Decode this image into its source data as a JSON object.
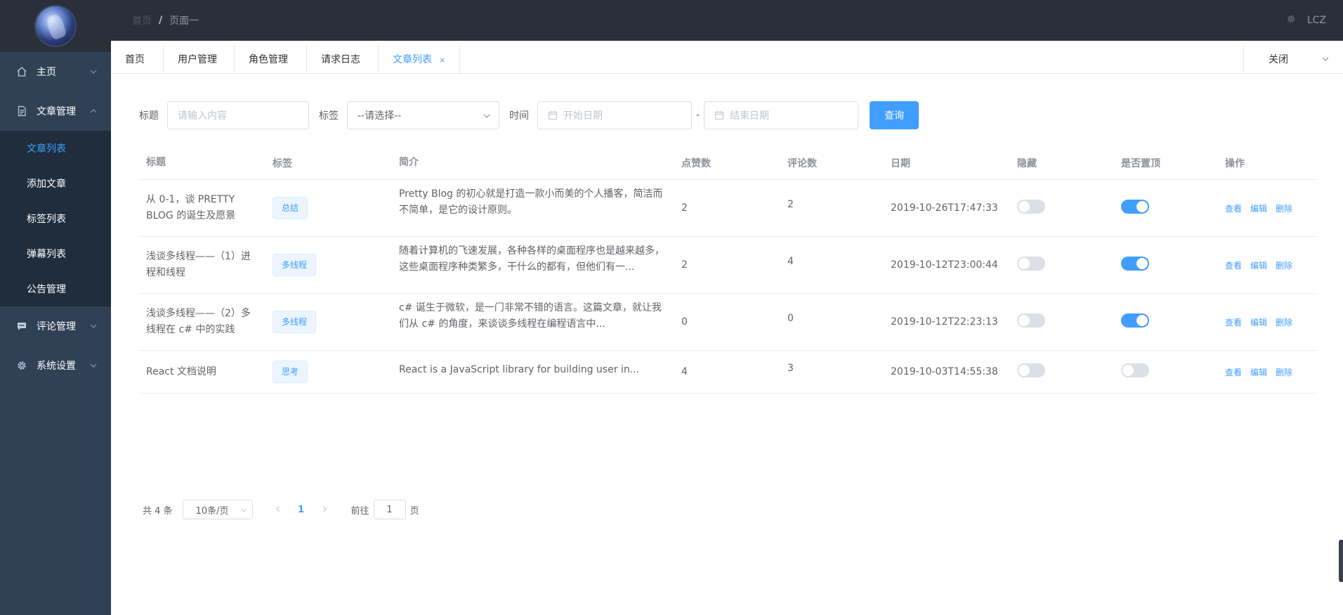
{
  "sidebar": {
    "menu": [
      {
        "label": "主页"
      },
      {
        "label": "文章管理"
      },
      {
        "label": "评论管理"
      },
      {
        "label": "系统设置"
      }
    ],
    "submenu": [
      {
        "label": "文章列表"
      },
      {
        "label": "添加文章"
      },
      {
        "label": "标签列表"
      },
      {
        "label": "弹幕列表"
      },
      {
        "label": "公告管理"
      }
    ]
  },
  "header": {
    "breadcrumb_home": "首页",
    "breadcrumb_sep": "/",
    "breadcrumb_current": "页面一",
    "user": "LCZ"
  },
  "tabs": {
    "items": [
      "首页",
      "用户管理",
      "角色管理",
      "请求日志",
      "文章列表"
    ],
    "close_icon": "×",
    "close_all_label": "关闭"
  },
  "filter": {
    "title_label": "标题",
    "title_placeholder": "请输入内容",
    "tag_label": "标签",
    "tag_selected": "--请选择--",
    "time_label": "时间",
    "start_placeholder": "开始日期",
    "range_sep": "-",
    "end_placeholder": "结束日期",
    "query_button": "查询"
  },
  "table": {
    "headers": [
      "标题",
      "标签",
      "简介",
      "点赞数",
      "评论数",
      "日期",
      "隐藏",
      "是否置顶",
      "操作"
    ],
    "rows": [
      {
        "title": "从 0-1，谈 PRETTY BLOG 的诞生及愿景",
        "tag": "总结",
        "desc": "Pretty Blog 的初心就是打造一款小而美的个人播客，简洁而不简单，是它的设计原则。",
        "likes": "2",
        "comments": "2",
        "date": "2019-10-26T17:47:33",
        "hidden": false,
        "top": true
      },
      {
        "title": "浅谈多线程——（1）进程和线程",
        "tag": "多线程",
        "desc": "随着计算机的飞速发展，各种各样的桌面程序也是越来越多，这些桌面程序种类繁多，干什么的都有，但他们有一...",
        "likes": "2",
        "comments": "4",
        "date": "2019-10-12T23:00:44",
        "hidden": false,
        "top": true
      },
      {
        "title": "浅谈多线程——（2）多线程在 c# 中的实践",
        "tag": "多线程",
        "desc": "c# 诞生于微软，是一门非常不错的语言。这篇文章，就让我们从 c# 的角度，来谈谈多线程在编程语言中...",
        "likes": "0",
        "comments": "0",
        "date": "2019-10-12T22:23:13",
        "hidden": false,
        "top": true
      },
      {
        "title": "React 文档说明",
        "tag": "思考",
        "desc": "React is a JavaScript library for building user in...",
        "likes": "4",
        "comments": "3",
        "date": "2019-10-03T14:55:38",
        "hidden": false,
        "top": false
      }
    ],
    "ops": {
      "view": "查看",
      "edit": "编辑",
      "delete": "删除"
    }
  },
  "pagination": {
    "total_label": "共 4 条",
    "page_size": "10条/页",
    "current_page": "1",
    "goto_label": "前往",
    "goto_value": "1",
    "page_suffix": "页"
  },
  "colors": {
    "primary": "#409eff",
    "sidebar_bg": "#304156",
    "header_bg": "#2b2f3a"
  }
}
